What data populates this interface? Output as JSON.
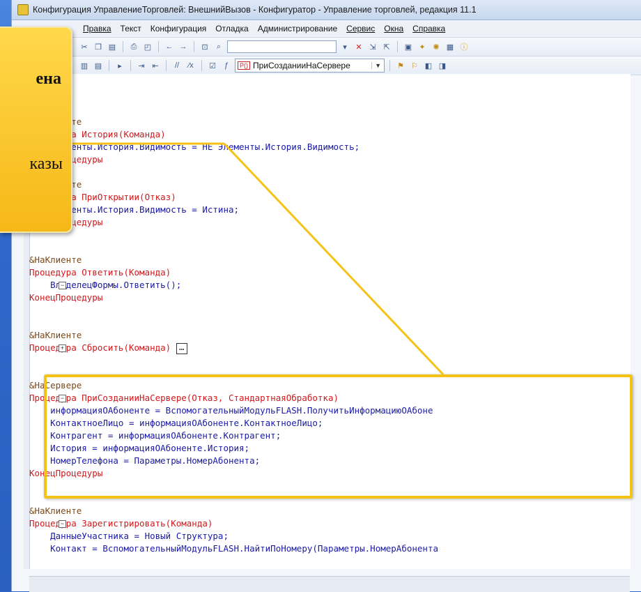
{
  "window": {
    "title": "Конфигурация УправлениеТорговлей: ВнешнийВызов - Конфигуратор - Управление торговлей, редакция 11.1"
  },
  "menu": {
    "items": [
      "Правка",
      "Текст",
      "Конфигурация",
      "Отладка",
      "Администрирование",
      "Сервис",
      "Окна",
      "Справка"
    ]
  },
  "toolbar": {
    "search_value": "",
    "procedure_badge": "Р()",
    "procedure_select": "ПриСозданииНаСервере"
  },
  "callout": {
    "text1": "ена",
    "text2": "казы"
  },
  "code": {
    "lines": [
      {
        "text": "&НаКлиенте"
      },
      {
        "text": "Процедура История(Команда)"
      },
      {
        "text": "    Элементы.История.Видимость = НЕ Элементы.История.Видимость;"
      },
      {
        "text": "КонецПроцедуры"
      },
      {
        "text": ""
      },
      {
        "text": "&НаКлиенте"
      },
      {
        "text": "Процедура ПриОткрытии(Отказ)"
      },
      {
        "text": "    Элементы.История.Видимость = Истина;"
      },
      {
        "text": "КонецПроцедуры"
      },
      {
        "text": ""
      },
      {
        "text": "&НаКлиенте"
      },
      {
        "text": "Процедура Ответить(Команда)"
      },
      {
        "text": "    ВладелецФормы.Ответить();"
      },
      {
        "text": "КонецПроцедуры"
      },
      {
        "text": ""
      },
      {
        "text": "&НаКлиенте"
      },
      {
        "text": "Процедура Сбросить(Команда)"
      },
      {
        "text": ""
      },
      {
        "text": ""
      },
      {
        "text": "&НаСервере"
      },
      {
        "text": "Процедура ПриСозданииНаСервере(Отказ, СтандартнаяОбработка)"
      },
      {
        "text": "    информацияОАбоненте = ВспомогательныйМодульFLASH.ПолучитьИнформациюОАбоне"
      },
      {
        "text": "    КонтактноеЛицо = информацияОАбоненте.КонтактноеЛицо;"
      },
      {
        "text": "    Контрагент = информацияОАбоненте.Контрагент;"
      },
      {
        "text": "    История = информацияОАбоненте.История;"
      },
      {
        "text": "    НомерТелефона = Параметры.НомерАбонента;"
      },
      {
        "text": "КонецПроцедуры"
      },
      {
        "text": ""
      },
      {
        "text": "&НаКлиенте"
      },
      {
        "text": "Процедура Зарегистрировать(Команда)"
      },
      {
        "text": "    ДанныеУчастника = Новый Структура;"
      },
      {
        "text": "    Контакт = ВспомогательныйМодульFLASH.НайтиПоНомеру(Параметры.НомерАбонента"
      }
    ]
  }
}
